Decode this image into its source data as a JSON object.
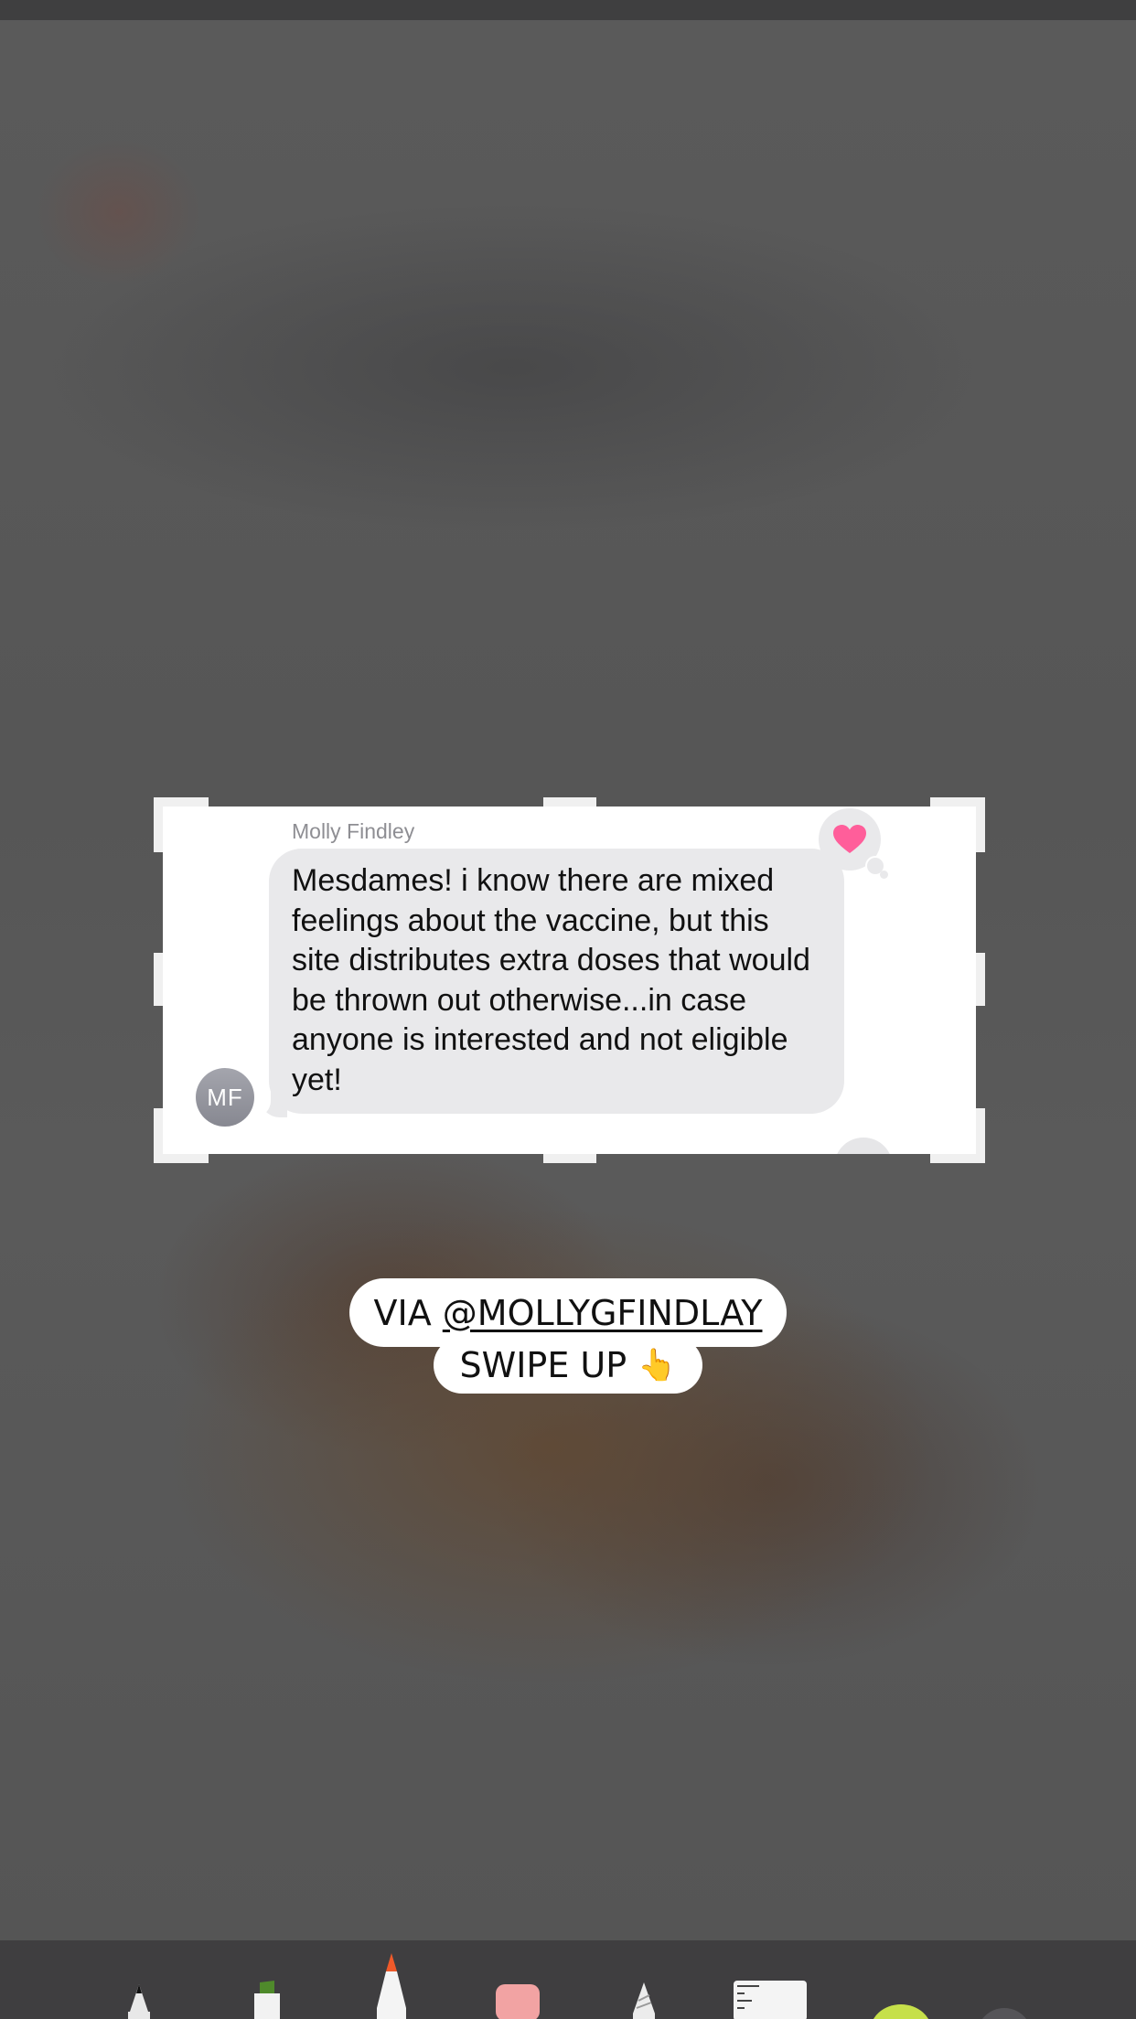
{
  "message": {
    "sender_name": "Molly Findley",
    "text": "Mesdames! i know there are mixed feelings about the vaccine, but this site distributes extra doses that would be thrown out otherwise...in case anyone is interested and not eligible yet!",
    "avatar_initials": "MF",
    "reaction": "heart-icon"
  },
  "caption": {
    "prefix": "VIA ",
    "mention": "@MOLLYGFINDLAY",
    "swipe_label": "SWIPE UP",
    "swipe_emoji": "👆"
  },
  "toolbar": {
    "tools": [
      "pen-tool-icon",
      "marker-tool-icon",
      "pencil-tool-icon",
      "eraser-tool-icon",
      "lasso-tool-icon",
      "ruler-tool-icon",
      "color-picker-icon"
    ]
  },
  "colors": {
    "reaction_heart": "#ff5e9a",
    "bubble": "#e9e9eb",
    "toolbar": "#3f3e40"
  }
}
